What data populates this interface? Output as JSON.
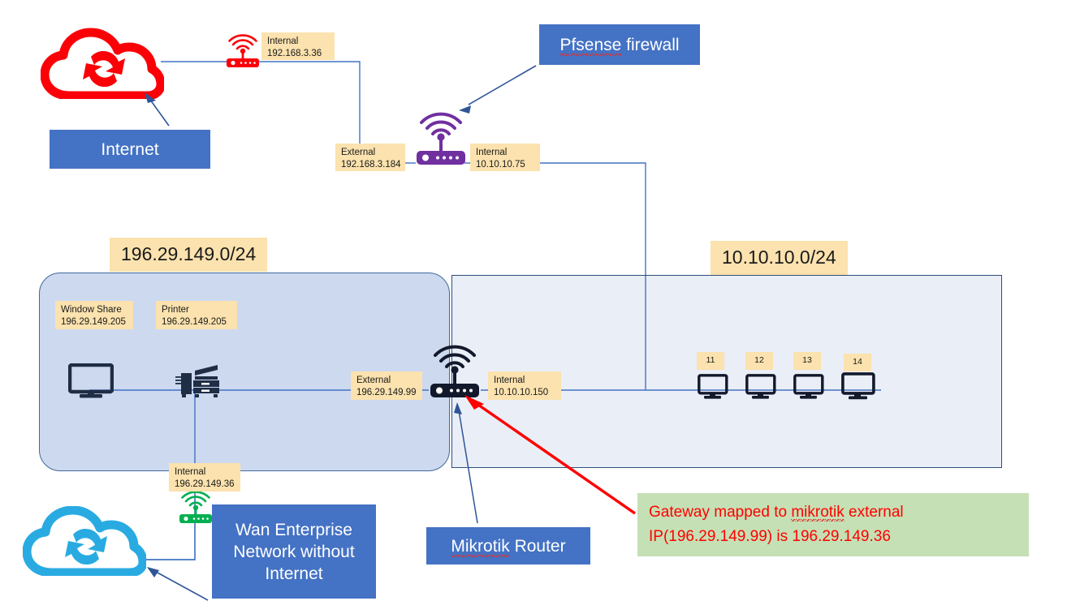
{
  "diagram": {
    "title": "Network topology diagram",
    "colors": {
      "callout_blue": "#4472c4",
      "chip_tan": "#fbe2ae",
      "note_green_bg": "#c5e0b4",
      "note_red_text": "#ff0000",
      "subnet_left_fill": "#cdd9ef",
      "subnet_right_fill": "#eaeef7",
      "line_blue": "#4472c4",
      "cloud_red": "#fb0007",
      "cloud_blue": "#29abe2",
      "router_red": "#fb0007",
      "router_purple": "#7030a0",
      "router_green": "#00b050",
      "router_dark": "#1f2d45"
    }
  },
  "callouts": {
    "internet": "Internet",
    "pfsense": "Pfsense firewall",
    "pfsense_word1": "Pfsense",
    "pfsense_word2": " firewall",
    "mikrotik": "Mikrotik Router",
    "mikrotik_word1": "Mikrotik",
    "mikrotik_word2": " Router",
    "wan_enterprise": "Wan Enterprise Network without Internet"
  },
  "subnets": {
    "left_label": "196.29.149.0/24",
    "right_label": "10.10.10.0/24"
  },
  "routers": {
    "isp": {
      "name": "ISP router",
      "iface": "Internal",
      "ip": "192.168.3.36",
      "label": "Internal\n192.168.3.36",
      "color": "red"
    },
    "pfsense_external": {
      "iface": "External",
      "ip": "192.168.3.184",
      "label": "External\n192.168.3.184"
    },
    "pfsense_internal": {
      "iface": "Internal",
      "ip": "10.10.10.75",
      "label": "Internal\n10.10.10.75"
    },
    "mikrotik_external": {
      "iface": "External",
      "ip": "196.29.149.99",
      "label": "External\n196.29.149.99"
    },
    "mikrotik_internal": {
      "iface": "Internal",
      "ip": "10.10.10.150",
      "label": "Internal\n10.10.10.150"
    },
    "wan_internal": {
      "iface": "Internal",
      "ip": "196.29.149.36",
      "label": "Internal\n196.29.149.36"
    }
  },
  "hosts": {
    "window_share": {
      "name": "Window Share",
      "ip": "196.29.149.205",
      "label": "Window Share\n196.29.149.205"
    },
    "printer": {
      "name": "Printer",
      "ip": "196.29.149.205",
      "label": "Printer\n196.29.149.205"
    },
    "lan_pcs": [
      {
        "label": "11"
      },
      {
        "label": "12"
      },
      {
        "label": "13"
      },
      {
        "label": "14"
      }
    ]
  },
  "note": {
    "line1_a": "Gateway mapped to ",
    "line1_b": "mikrotik",
    "line1_c": " external",
    "line2": "IP(196.29.149.99)   is 196.29.149.36",
    "full_text": "Gateway mapped to mikrotik external IP(196.29.149.99)   is 196.29.149.36"
  }
}
